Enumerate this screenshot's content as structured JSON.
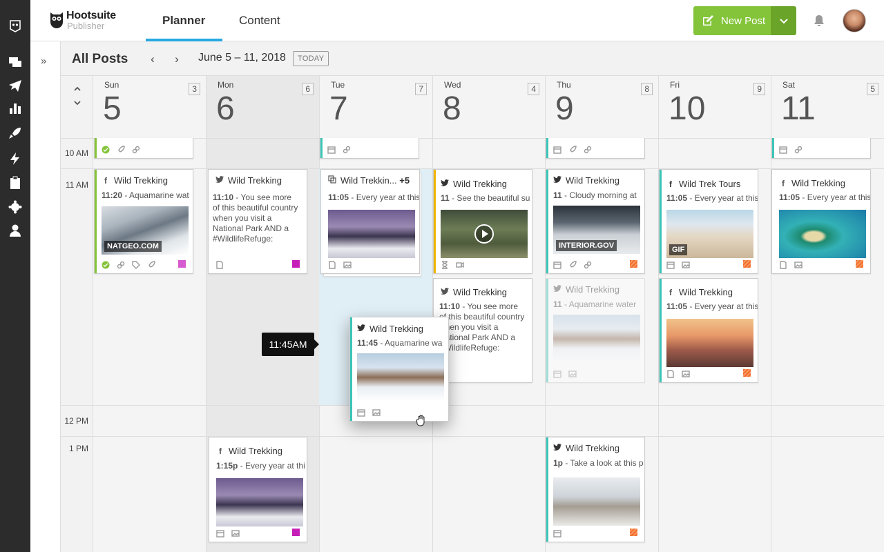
{
  "app": {
    "logo_name": "Hootsuite",
    "logo_product": "Publisher"
  },
  "nav": {
    "tabs": [
      {
        "label": "Planner",
        "active": true
      },
      {
        "label": "Content",
        "active": false
      }
    ],
    "new_post_label": "New Post",
    "expand_icon": "»"
  },
  "rail_icons": [
    "hootsuite-owl-icon",
    "streams-icon",
    "publisher-icon",
    "analytics-icon",
    "boost-icon",
    "automation-icon",
    "assignments-icon",
    "apps-icon",
    "profile-icon"
  ],
  "calendar": {
    "title": "All Posts",
    "range": "June 5 – 11, 2018",
    "today_label": "TODAY",
    "prev": "‹",
    "next": "›",
    "days": [
      {
        "name": "Sun",
        "num": "5",
        "count": "3"
      },
      {
        "name": "Mon",
        "num": "6",
        "count": "6"
      },
      {
        "name": "Tue",
        "num": "7",
        "count": "7"
      },
      {
        "name": "Wed",
        "num": "8",
        "count": "4"
      },
      {
        "name": "Thu",
        "num": "9",
        "count": "8"
      },
      {
        "name": "Fri",
        "num": "10",
        "count": "9"
      },
      {
        "name": "Sat",
        "num": "11",
        "count": "5"
      }
    ],
    "times": [
      "10 AM",
      "11 AM",
      "12 PM",
      "1 PM"
    ]
  },
  "posts": {
    "sun_11": {
      "network": "f",
      "account": "Wild Trekking",
      "time": "11:20",
      "text": "- Aquamarine wat",
      "image_tag": "NATGEO.COM"
    },
    "mon_11": {
      "network": "twitter",
      "account": "Wild Trekking",
      "time": "11:10",
      "text": "- You see more of this beautiful country when you visit a National Park AND a #WildlifeRefuge:"
    },
    "tue_11": {
      "network": "multi",
      "account": "Wild Trekkin...",
      "extra": "+5",
      "time": "11:05",
      "text": "- Every year at this"
    },
    "wed_11": {
      "network": "twitter",
      "account": "Wild Trekking",
      "time": "11",
      "text": "- See the beautiful su"
    },
    "wed_1110": {
      "network": "twitter",
      "account": "Wild Trekking",
      "time": "11:10",
      "text": "- You see more of this beautiful country when you visit a National Park AND a #WildlifeRefuge:"
    },
    "thu_11": {
      "network": "twitter",
      "account": "Wild Trekking",
      "time": "11",
      "text": "- Cloudy morning at",
      "image_tag": "INTERIOR.GOV"
    },
    "thu_11b": {
      "network": "twitter",
      "account": "Wild Trekking",
      "time": "11",
      "text": "- Aquamarine water"
    },
    "fri_11": {
      "network": "f",
      "account": "Wild Trek Tours",
      "time": "11:05",
      "text": "- Every year at this",
      "image_tag": "GIF"
    },
    "fri_11b": {
      "network": "f",
      "account": "Wild Trekking",
      "time": "11:05",
      "text": "- Every year at this"
    },
    "sat_11": {
      "network": "f",
      "account": "Wild Trekking",
      "time": "11:05",
      "text": "- Every year at this"
    },
    "dragged": {
      "network": "twitter",
      "account": "Wild Trekking",
      "time": "11:45",
      "text": "- Aquamarine wa"
    },
    "mon_1pm": {
      "network": "f",
      "account": "Wild Trekking",
      "time": "1:15p",
      "text": "- Every year at thi"
    },
    "thu_1pm": {
      "network": "twitter",
      "account": "Wild Trekking",
      "time": "1p",
      "text": "- Take a look at this p"
    }
  },
  "drag_tooltip": "11:45AM",
  "colors": {
    "accent_green": "#84c43a",
    "accent_blue": "#27a8e0",
    "teal_bar": "#3cc4b8",
    "amber_bar": "#f0b400",
    "magenta": "#c51fb8",
    "orange": "#f26b2a"
  }
}
